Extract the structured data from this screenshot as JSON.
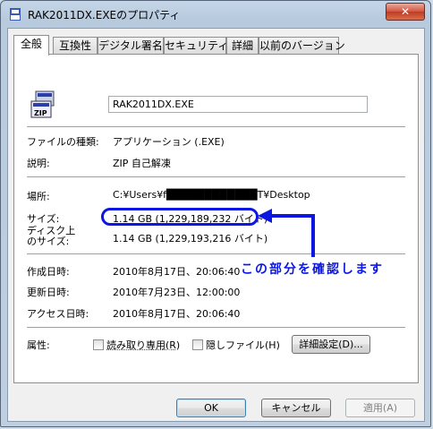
{
  "window": {
    "title": "RAK2011DX.EXEのプロパティ",
    "close_label": "✕"
  },
  "tabs": [
    {
      "label": "全般"
    },
    {
      "label": "互換性"
    },
    {
      "label": "デジタル署名"
    },
    {
      "label": "セキュリティ"
    },
    {
      "label": "詳細"
    },
    {
      "label": "以前のバージョン"
    }
  ],
  "general": {
    "file_name": "RAK2011DX.EXE",
    "file_type_label": "ファイルの種類:",
    "file_type_value": "アプリケーション (.EXE)",
    "description_label": "説明:",
    "description_value": "ZIP 自己解凍",
    "location_label": "場所:",
    "location_value": "C:¥Users¥f████████████T¥Desktop",
    "size_label": "サイズ:",
    "size_value": "1.14 GB (1,229,189,232 バイト)",
    "size_on_disk_label_1": "ディスク上",
    "size_on_disk_label_2": "のサイズ:",
    "size_on_disk_value": "1.14 GB (1,229,193,216 バイト)",
    "created_label": "作成日時:",
    "created_value": "2010年8月17日、20:06:40",
    "modified_label": "更新日時:",
    "modified_value": "2010年7月23日、12:00:00",
    "accessed_label": "アクセス日時:",
    "accessed_value": "2010年8月17日、20:06:40",
    "attributes_label": "属性:",
    "readonly_label": "読み取り専用(R)",
    "hidden_label": "隠しファイル(H)",
    "advanced_button": "詳細設定(D)..."
  },
  "annotation": {
    "text": "この部分を確認します",
    "color": "#0b16e3"
  },
  "buttons": {
    "ok": "OK",
    "cancel": "キャンセル",
    "apply": "適用(A)"
  }
}
